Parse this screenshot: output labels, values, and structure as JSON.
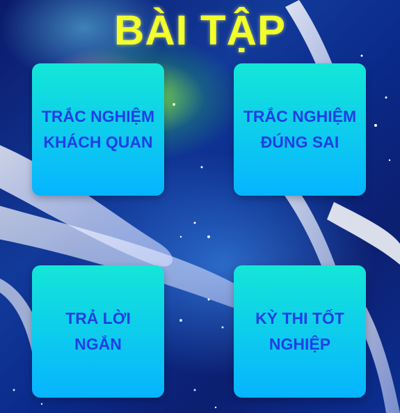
{
  "page": {
    "title": "BÀI TẬP",
    "title_color": "#f2ff2a",
    "card_text_color": "#1f3fe6",
    "card_gradient": [
      "#14e6d8",
      "#06b4ff"
    ]
  },
  "cards": [
    {
      "line1": "TRẮC NGHIỆM",
      "line2": "KHÁCH QUAN"
    },
    {
      "line1": "TRẮC NGHIỆM",
      "line2": "ĐÚNG SAI"
    },
    {
      "line1": "TRẢ LỜI",
      "line2": "NGẮN"
    },
    {
      "line1": "KỲ THI TỐT",
      "line2": "NGHIỆP"
    }
  ]
}
